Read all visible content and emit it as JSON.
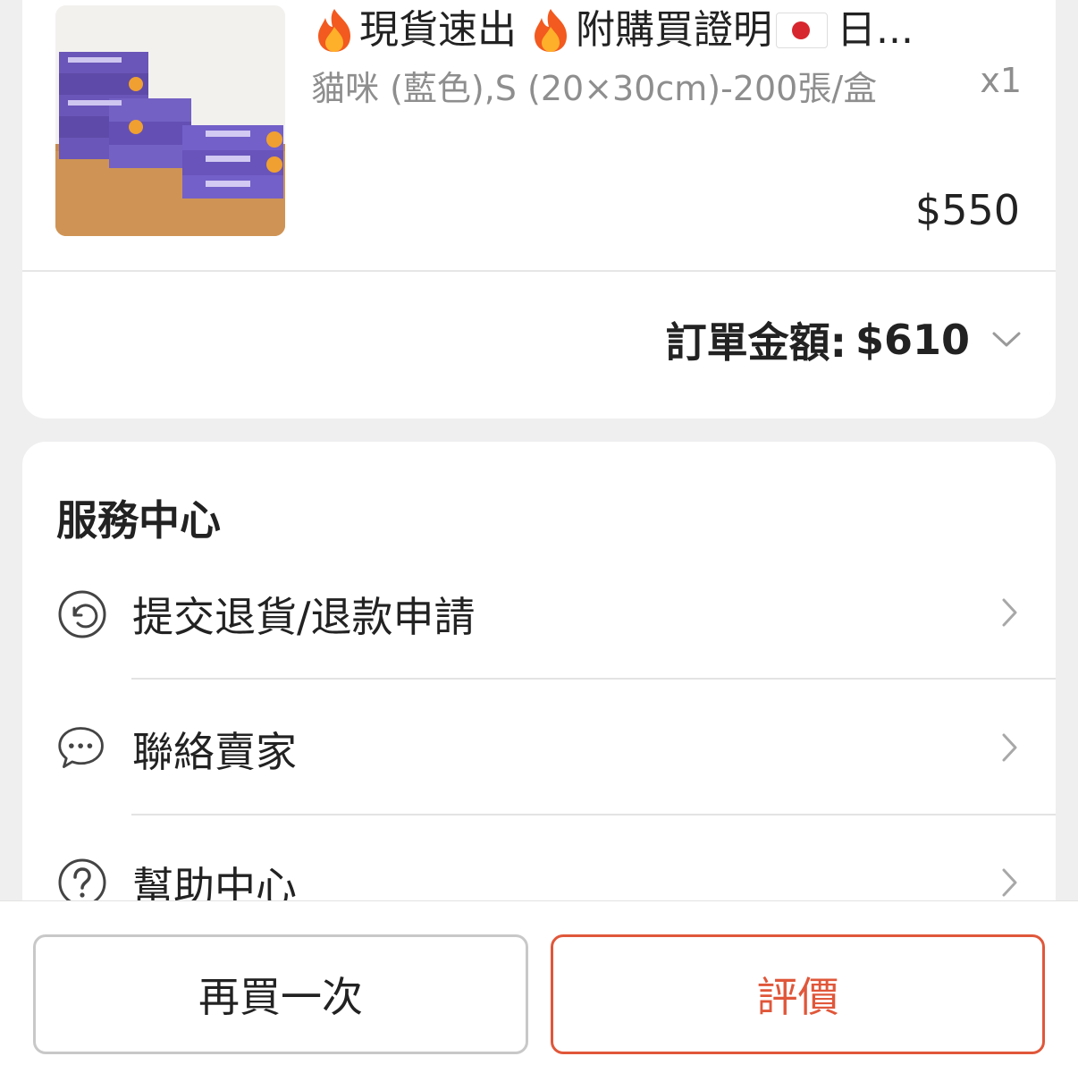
{
  "order": {
    "product": {
      "title": "現貨速出",
      "title_part2": "附購買證明",
      "title_part3": "日...",
      "variant": "貓咪 (藍色),S (20×30cm)-200張/盒",
      "quantity": "x1",
      "price": "$550"
    },
    "total_label": "訂單金額:",
    "total_value": "$610"
  },
  "service_center": {
    "title": "服務中心",
    "items": [
      {
        "label": "提交退貨/退款申請",
        "icon": "return-icon"
      },
      {
        "label": "聯絡賣家",
        "icon": "chat-icon"
      },
      {
        "label": "幫助中心",
        "icon": "help-icon"
      }
    ]
  },
  "actions": {
    "buy_again_label": "再買一次",
    "rate_label": "評價"
  },
  "colors": {
    "accent": "#e0573a",
    "background": "#efeff0",
    "muted_text": "#8e8e8e"
  }
}
